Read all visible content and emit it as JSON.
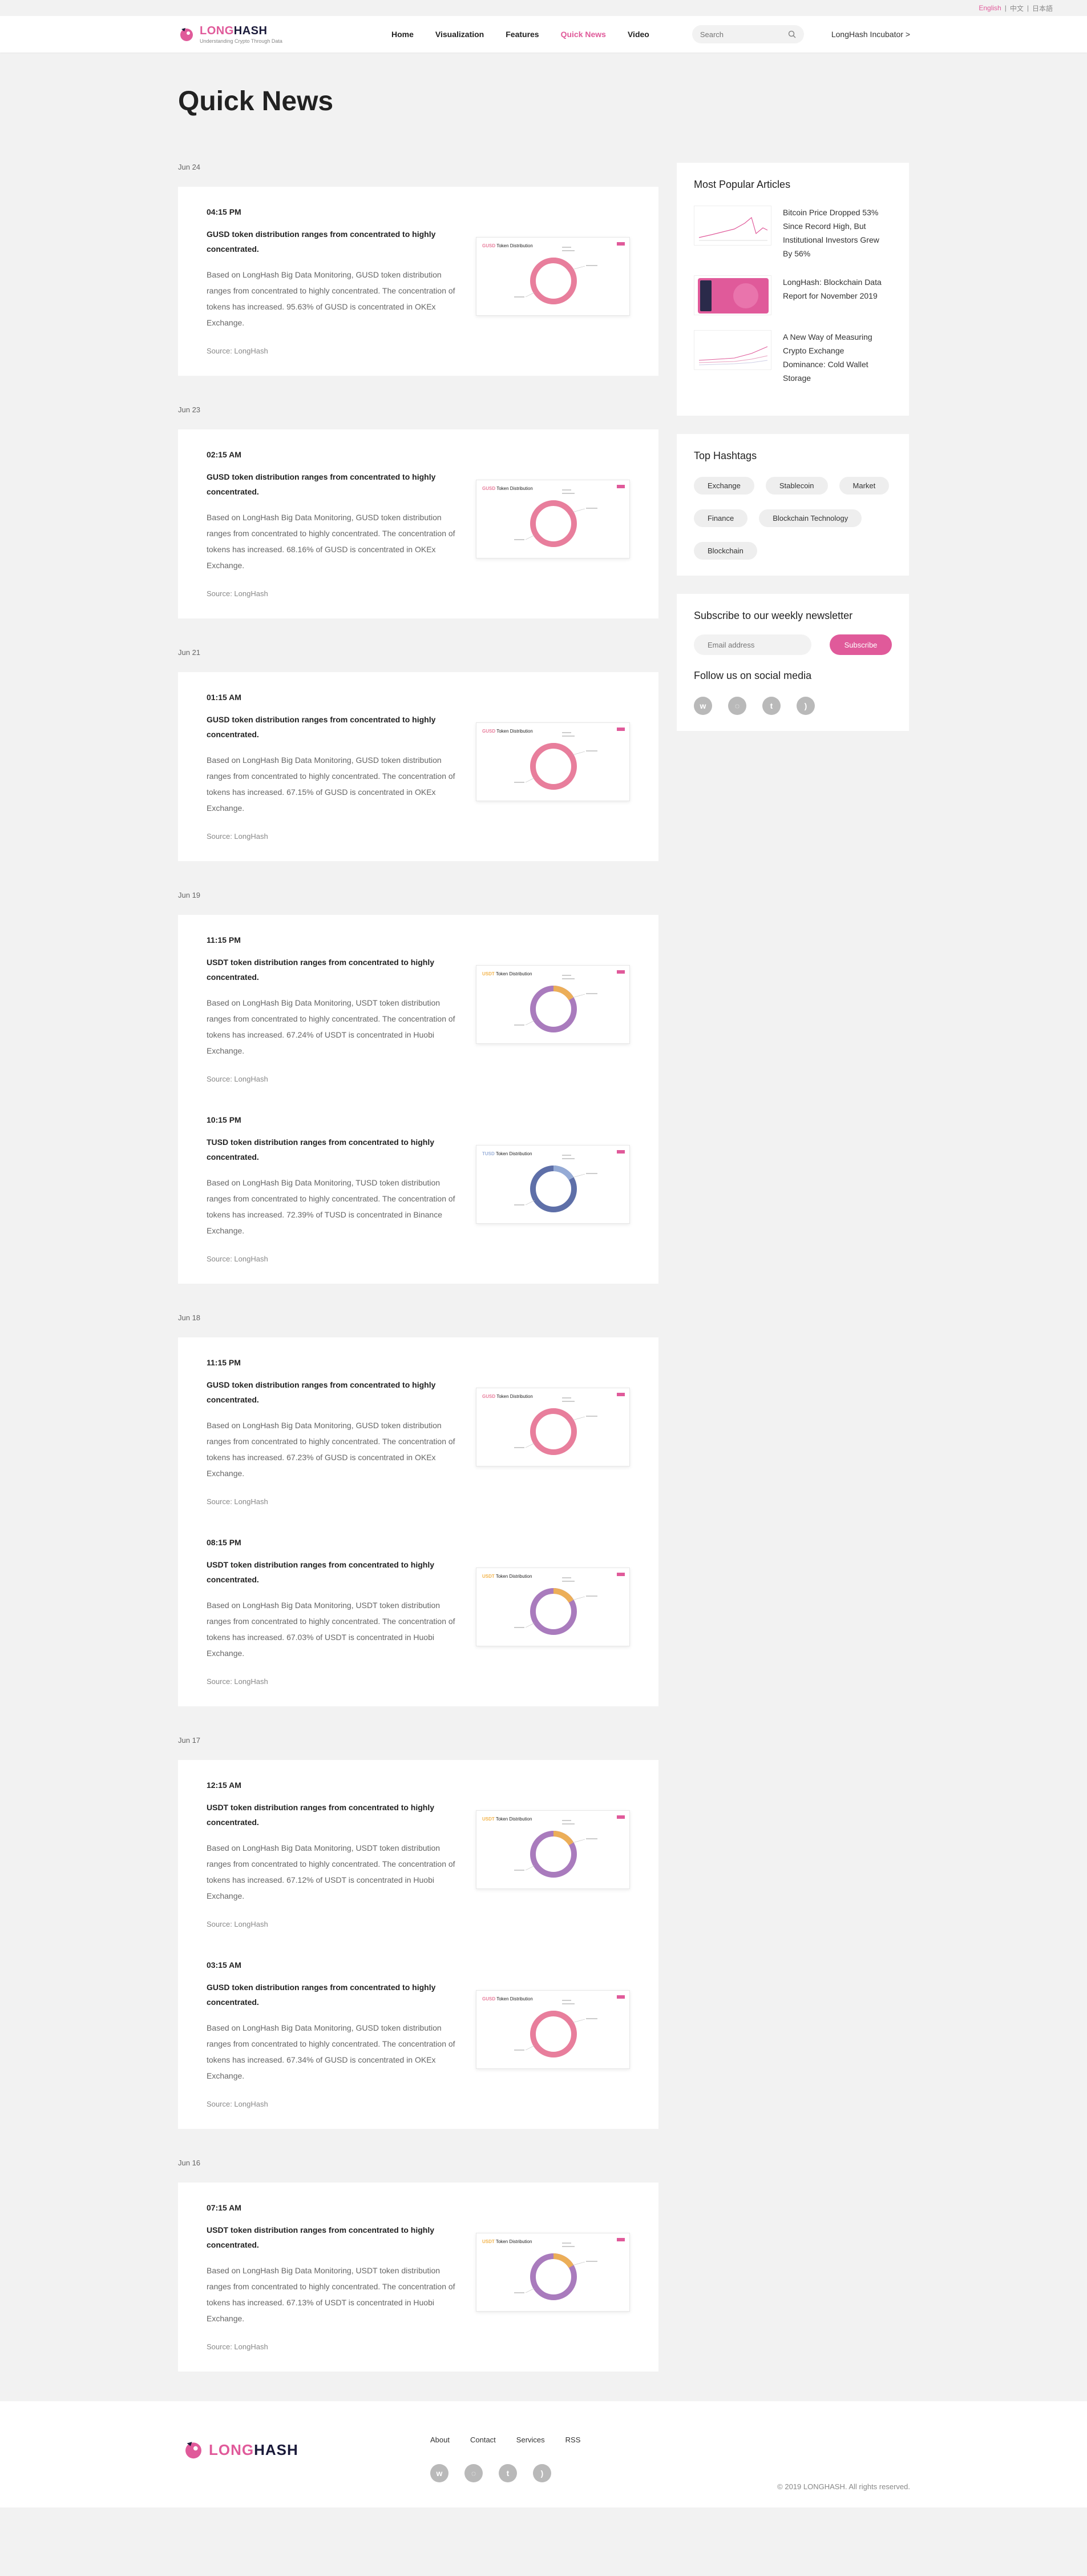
{
  "lang": {
    "english": "English",
    "sep1": "|",
    "chinese": "中文",
    "sep2": "|",
    "japanese": "日本語"
  },
  "header": {
    "logo_long": "LONG",
    "logo_hash": "HASH",
    "tagline": "Understanding Crypto Through Data",
    "nav": [
      "Home",
      "Visualization",
      "Features",
      "Quick News",
      "Video"
    ],
    "search_placeholder": "Search",
    "incubator": "LongHash Incubator >"
  },
  "page_title": "Quick News",
  "groups": [
    {
      "date": "Jun 24",
      "items": [
        {
          "time": "04:15 PM",
          "headline": "GUSD token distribution ranges from concentrated to highly concentrated.",
          "body": "Based on LongHash Big Data Monitoring, GUSD token distribution ranges from concentrated to highly concentrated. The concentration of tokens has increased. 95.63% of GUSD is concentrated in OKEx Exchange.",
          "source": "Source: LongHash",
          "thumb_token": "GUSD",
          "thumb_title": "Token Distribution",
          "ring_color": "#e87e9c",
          "accent": "#e87e9c"
        }
      ]
    },
    {
      "date": "Jun 23",
      "items": [
        {
          "time": "02:15 AM",
          "headline": "GUSD token distribution ranges from concentrated to highly concentrated.",
          "body": "Based on LongHash Big Data Monitoring, GUSD token distribution ranges from concentrated to highly concentrated. The concentration of tokens has increased. 68.16% of GUSD is concentrated in OKEx Exchange.",
          "source": "Source: LongHash",
          "thumb_token": "GUSD",
          "thumb_title": "Token Distribution",
          "ring_color": "#e87e9c",
          "accent": "#e87e9c"
        }
      ]
    },
    {
      "date": "Jun 21",
      "items": [
        {
          "time": "01:15 AM",
          "headline": "GUSD token distribution ranges from concentrated to highly concentrated.",
          "body": "Based on LongHash Big Data Monitoring, GUSD token distribution ranges from concentrated to highly concentrated. The concentration of tokens has increased. 67.15% of GUSD is concentrated in OKEx Exchange.",
          "source": "Source: LongHash",
          "thumb_token": "GUSD",
          "thumb_title": "Token Distribution",
          "ring_color": "#e87e9c",
          "accent": "#e87e9c"
        }
      ]
    },
    {
      "date": "Jun 19",
      "items": [
        {
          "time": "11:15 PM",
          "headline": "USDT token distribution ranges from concentrated to highly concentrated.",
          "body": "Based on LongHash Big Data Monitoring, USDT token distribution ranges from concentrated to highly concentrated. The concentration of tokens has increased. 67.24% of USDT is concentrated in Huobi Exchange.",
          "source": "Source: LongHash",
          "thumb_token": "USDT",
          "thumb_title": "Token Distribution",
          "ring_color": "#a97bbd",
          "accent": "#f3b44c"
        },
        {
          "time": "10:15 PM",
          "headline": "TUSD token distribution ranges from concentrated to highly concentrated.",
          "body": "Based on LongHash Big Data Monitoring, TUSD token distribution ranges from concentrated to highly concentrated. The concentration of tokens has increased. 72.39% of TUSD is concentrated in Binance Exchange.",
          "source": "Source: LongHash",
          "thumb_token": "TUSD",
          "thumb_title": "Token Distribution",
          "ring_color": "#5e6fa8",
          "accent": "#9ab0d9"
        }
      ]
    },
    {
      "date": "Jun 18",
      "items": [
        {
          "time": "11:15 PM",
          "headline": "GUSD token distribution ranges from concentrated to highly concentrated.",
          "body": "Based on LongHash Big Data Monitoring, GUSD token distribution ranges from concentrated to highly concentrated. The concentration of tokens has increased. 67.23% of GUSD is concentrated in OKEx Exchange.",
          "source": "Source: LongHash",
          "thumb_token": "GUSD",
          "thumb_title": "Token Distribution",
          "ring_color": "#e87e9c",
          "accent": "#e87e9c"
        },
        {
          "time": "08:15 PM",
          "headline": "USDT token distribution ranges from concentrated to highly concentrated.",
          "body": "Based on LongHash Big Data Monitoring, USDT token distribution ranges from concentrated to highly concentrated. The concentration of tokens has increased. 67.03% of USDT is concentrated in Huobi Exchange.",
          "source": "Source: LongHash",
          "thumb_token": "USDT",
          "thumb_title": "Token Distribution",
          "ring_color": "#a97bbd",
          "accent": "#f3b44c"
        }
      ]
    },
    {
      "date": "Jun 17",
      "items": [
        {
          "time": "12:15 AM",
          "headline": "USDT token distribution ranges from concentrated to highly concentrated.",
          "body": "Based on LongHash Big Data Monitoring, USDT token distribution ranges from concentrated to highly concentrated. The concentration of tokens has increased. 67.12% of USDT is concentrated in Huobi Exchange.",
          "source": "Source: LongHash",
          "thumb_token": "USDT",
          "thumb_title": "Token Distribution",
          "ring_color": "#a97bbd",
          "accent": "#f3b44c"
        },
        {
          "time": "03:15 AM",
          "headline": "GUSD token distribution ranges from concentrated to highly concentrated.",
          "body": "Based on LongHash Big Data Monitoring, GUSD token distribution ranges from concentrated to highly concentrated. The concentration of tokens has increased. 67.34% of GUSD is concentrated in OKEx Exchange.",
          "source": "Source: LongHash",
          "thumb_token": "GUSD",
          "thumb_title": "Token Distribution",
          "ring_color": "#e87e9c",
          "accent": "#e87e9c"
        }
      ]
    },
    {
      "date": "Jun 16",
      "items": [
        {
          "time": "07:15 AM",
          "headline": "USDT token distribution ranges from concentrated to highly concentrated.",
          "body": "Based on LongHash Big Data Monitoring, USDT token distribution ranges from concentrated to highly concentrated. The concentration of tokens has increased. 67.13% of USDT is concentrated in Huobi Exchange.",
          "source": "Source: LongHash",
          "thumb_token": "USDT",
          "thumb_title": "Token Distribution",
          "ring_color": "#a97bbd",
          "accent": "#f3b44c"
        }
      ]
    }
  ],
  "sidebar": {
    "popular_title": "Most Popular Articles",
    "popular": [
      {
        "title": "Bitcoin Price Dropped 53% Since Record High, But Institutional Investors Grew By 56%",
        "thumb": "line-chart"
      },
      {
        "title": "LongHash: Blockchain Data Report for November 2019",
        "thumb": "pink-report"
      },
      {
        "title": "A New Way of Measuring Crypto Exchange Dominance: Cold Wallet Storage",
        "thumb": "multi-line-chart"
      }
    ],
    "hashtags_title": "Top Hashtags",
    "hashtags": [
      "Exchange",
      "Stablecoin",
      "Market",
      "Finance",
      "Blockchain Technology",
      "Blockchain"
    ],
    "newsletter_title": "Subscribe to our weekly newsletter",
    "email_placeholder": "Email address",
    "subscribe_label": "Subscribe",
    "follow_title": "Follow us on social media",
    "social": [
      "weibo-icon",
      "wechat-icon",
      "twitter-icon",
      "rss-icon"
    ]
  },
  "footer": {
    "links": [
      "About",
      "Contact",
      "Services",
      "RSS"
    ],
    "logo_long": "LONG",
    "logo_hash": "HASH",
    "copyright": "© 2019 LONGHASH. All rights reserved."
  },
  "colors": {
    "accent": "#e05a9a",
    "dark": "#1a1a3a",
    "bg": "#f2f2f2"
  }
}
